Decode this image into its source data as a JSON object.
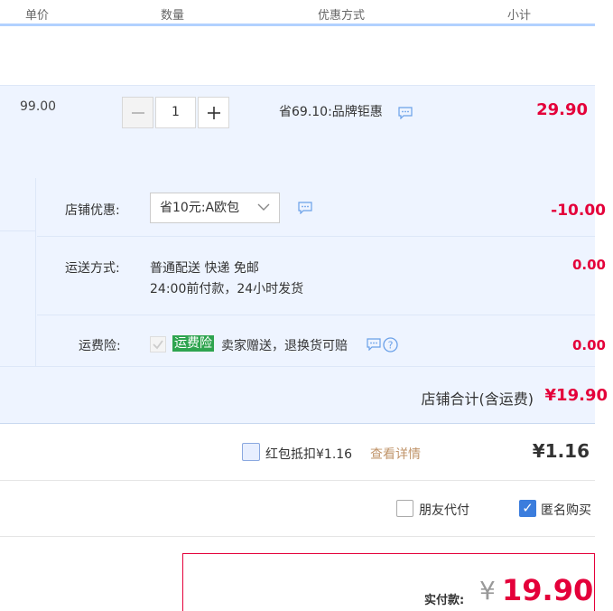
{
  "header": {
    "col_unit_price": "单价",
    "col_quantity": "数量",
    "col_discount": "优惠方式",
    "col_subtotal": "小计"
  },
  "item": {
    "unit_price": "99.00",
    "quantity": "1",
    "minus_label": "—",
    "plus_label": "+",
    "promo": "省69.10:品牌钜惠",
    "subtotal": "29.90"
  },
  "shop": {
    "coupon_label": "店铺优惠:",
    "coupon_selected": "省10元:A欧包",
    "coupon_value": "-10.00",
    "shipping_label": "运送方式:",
    "shipping_line1": "普通配送 快递 免邮",
    "shipping_line2": "24:00前付款，24小时发货",
    "shipping_value": "0.00",
    "insurance_label": "运费险:",
    "insurance_badge": "运费险",
    "insurance_text": "卖家赠送，退换货可赔",
    "insurance_value": "0.00",
    "total_label": "店铺合计(含运费)",
    "total_value": "¥19.90"
  },
  "red_packet": {
    "label": "红包抵扣¥1.16",
    "link": "查看详情",
    "value": "¥1.16"
  },
  "options": {
    "friend_pay": "朋友代付",
    "anonymous": "匿名购买",
    "check_mark": "✓"
  },
  "payment": {
    "label": "实付款:",
    "currency": "¥",
    "amount": "19.90"
  },
  "colors": {
    "accent_red": "#e4003a",
    "row_bg": "#eef4ff",
    "header_line": "#b2d1ff",
    "badge_green": "#2ea44f"
  }
}
